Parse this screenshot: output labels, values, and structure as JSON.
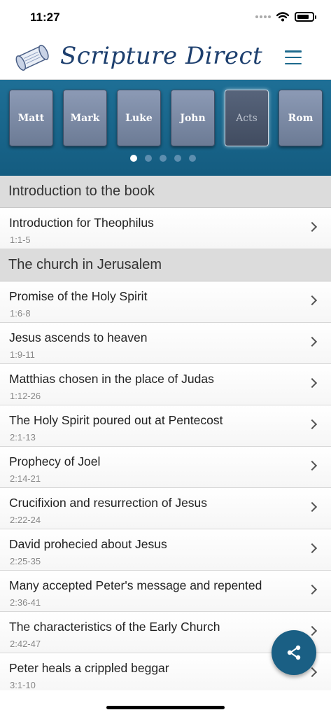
{
  "status_bar": {
    "time": "11:27"
  },
  "header": {
    "app_name": "Scripture Direct"
  },
  "books": [
    {
      "label": "Matt"
    },
    {
      "label": "Mark"
    },
    {
      "label": "Luke"
    },
    {
      "label": "John"
    },
    {
      "label": "Acts",
      "active": true
    },
    {
      "label": "Rom"
    }
  ],
  "carousel": {
    "page_count": 5,
    "current_page": 1
  },
  "sections": [
    {
      "title": "Introduction to the book",
      "items": [
        {
          "title": "Introduction for Theophilus",
          "ref": "1:1-5"
        }
      ]
    },
    {
      "title": "The church in Jerusalem",
      "items": [
        {
          "title": "Promise of the Holy Spirit",
          "ref": "1:6-8"
        },
        {
          "title": "Jesus ascends to heaven",
          "ref": "1:9-11"
        },
        {
          "title": "Matthias chosen in the place of Judas",
          "ref": "1:12-26"
        },
        {
          "title": "The Holy Spirit poured out at Pentecost",
          "ref": "2:1-13"
        },
        {
          "title": "Prophecy of Joel",
          "ref": "2:14-21"
        },
        {
          "title": "Crucifixion and resurrection of Jesus",
          "ref": "2:22-24"
        },
        {
          "title": "David prohecied about Jesus",
          "ref": "2:25-35"
        },
        {
          "title": "Many accepted Peter's message and repented",
          "ref": "2:36-41"
        },
        {
          "title": "The characteristics of the Early Church",
          "ref": "2:42-47"
        },
        {
          "title": "Peter heals a crippled beggar",
          "ref": "3:1-10"
        }
      ]
    }
  ],
  "icons": {
    "menu": "hamburger-menu-icon",
    "share": "share-icon",
    "chevron": "chevron-right-icon",
    "logo": "scroll-logo-icon"
  },
  "colors": {
    "brand": "#1d3f6e",
    "carousel_bg": "#1a6790",
    "fab": "#1a5f84",
    "section_bg": "#dcdcdc"
  }
}
